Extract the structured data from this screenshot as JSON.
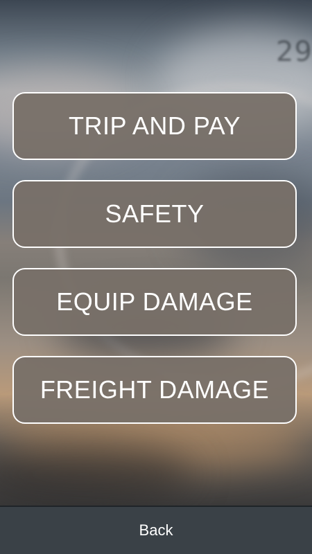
{
  "background": {
    "speedometer_text": "29"
  },
  "menu": {
    "items": [
      {
        "label": "TRIP AND PAY"
      },
      {
        "label": "SAFETY"
      },
      {
        "label": "EQUIP DAMAGE"
      },
      {
        "label": "FREIGHT DAMAGE"
      }
    ]
  },
  "footer": {
    "back_label": "Back"
  },
  "colors": {
    "button_fill": "#787068",
    "button_border": "#ffffff",
    "footer_bg": "#3a4147",
    "text": "#ffffff"
  }
}
